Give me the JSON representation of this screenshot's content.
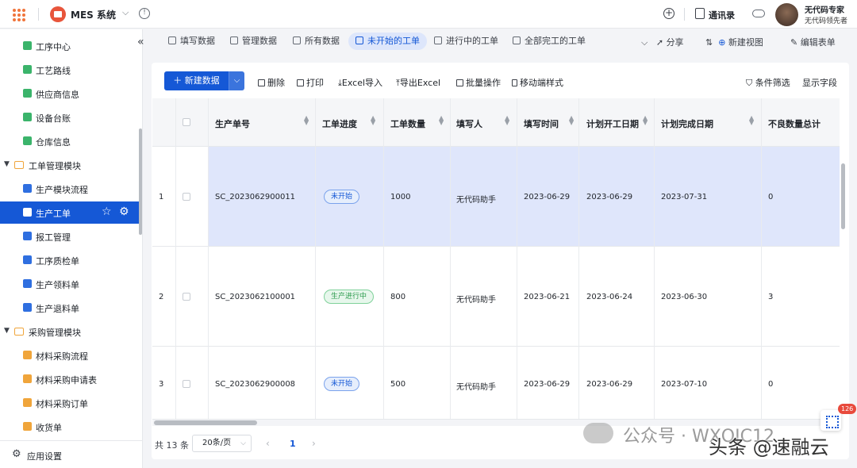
{
  "app": {
    "title": "MES 系统",
    "contacts": "通讯录",
    "user_name": "无代码专家",
    "user_title": "无代码领先者"
  },
  "sidebar": {
    "items": [
      {
        "label": "工序中心",
        "icon": "gear-cog-icon",
        "color": "#3bb46b"
      },
      {
        "label": "工艺路线",
        "icon": "list-icon",
        "color": "#3bb46b"
      },
      {
        "label": "供应商信息",
        "icon": "truck-icon",
        "color": "#3bb46b"
      },
      {
        "label": "设备台账",
        "icon": "device-icon",
        "color": "#3bb46b"
      },
      {
        "label": "仓库信息",
        "icon": "warehouse-icon",
        "color": "#3bb46b"
      },
      {
        "label": "工单管理模块",
        "group": true
      },
      {
        "label": "生产模块流程",
        "icon": "flow-icon",
        "color": "#2f6fe0"
      },
      {
        "label": "生产工单",
        "icon": "order-icon",
        "color": "#2f6fe0",
        "active": true
      },
      {
        "label": "报工管理",
        "icon": "report-icon",
        "color": "#2f6fe0"
      },
      {
        "label": "工序质检单",
        "icon": "check-icon",
        "color": "#2f6fe0"
      },
      {
        "label": "生产领料单",
        "icon": "pick-icon",
        "color": "#2f6fe0"
      },
      {
        "label": "生产退料单",
        "icon": "return-icon",
        "color": "#2f6fe0"
      },
      {
        "label": "采购管理模块",
        "group": true
      },
      {
        "label": "材料采购流程",
        "icon": "flow-icon",
        "color": "#f0a53b"
      },
      {
        "label": "材料采购申请表",
        "icon": "cart-icon",
        "color": "#f0a53b"
      },
      {
        "label": "材料采购订单",
        "icon": "order-icon",
        "color": "#f0a53b"
      },
      {
        "label": "收货单",
        "icon": "receipt-icon",
        "color": "#f0a53b"
      }
    ],
    "footer_label": "应用设置"
  },
  "views": {
    "tabs": [
      "填写数据",
      "管理数据",
      "所有数据",
      "未开始的工单",
      "进行中的工单",
      "全部完工的工单"
    ],
    "active_tab": "未开始的工单",
    "share": "分享",
    "new_view": "新建视图",
    "edit_form": "编辑表单"
  },
  "toolbar": {
    "new_data": "新建数据",
    "delete": "删除",
    "print": "打印",
    "import_excel": "Excel导入",
    "export_excel": "导出Excel",
    "batch": "批量操作",
    "mobile_style": "移动端样式",
    "filter": "条件筛选",
    "show_fields": "显示字段"
  },
  "table": {
    "columns": [
      "生产单号",
      "工单进度",
      "工单数量",
      "填写人",
      "填写时间",
      "计划开工日期",
      "计划完成日期",
      "不良数量总计"
    ],
    "rows": [
      {
        "index": "1",
        "order_no": "SC_2023062900011",
        "status": "未开始",
        "status_color": "blue",
        "qty": "1000",
        "filler": "无代码助手",
        "fill_time": "2023-06-29",
        "plan_start": "2023-06-29",
        "plan_end": "2023-07-31",
        "defects": "0"
      },
      {
        "index": "2",
        "order_no": "SC_2023062100001",
        "status": "生产进行中",
        "status_color": "green",
        "qty": "800",
        "filler": "无代码助手",
        "fill_time": "2023-06-21",
        "plan_start": "2023-06-24",
        "plan_end": "2023-06-30",
        "defects": "3"
      },
      {
        "index": "3",
        "order_no": "SC_2023062900008",
        "status": "未开始",
        "status_color": "blue",
        "qty": "500",
        "filler": "无代码助手",
        "fill_time": "2023-06-29",
        "plan_start": "2023-06-29",
        "plan_end": "2023-07-10",
        "defects": "0"
      }
    ]
  },
  "pagination": {
    "total": "共 13 条",
    "page_size": "20条/页",
    "current_page": "1"
  },
  "float_badge": "126",
  "watermark": {
    "text1": "公众号 · WXQJC12",
    "text2": "头条 @速融云"
  },
  "colors": {
    "primary": "#1558d6",
    "selected_row": "#dfe6fb",
    "badge": "#e84a3c"
  }
}
